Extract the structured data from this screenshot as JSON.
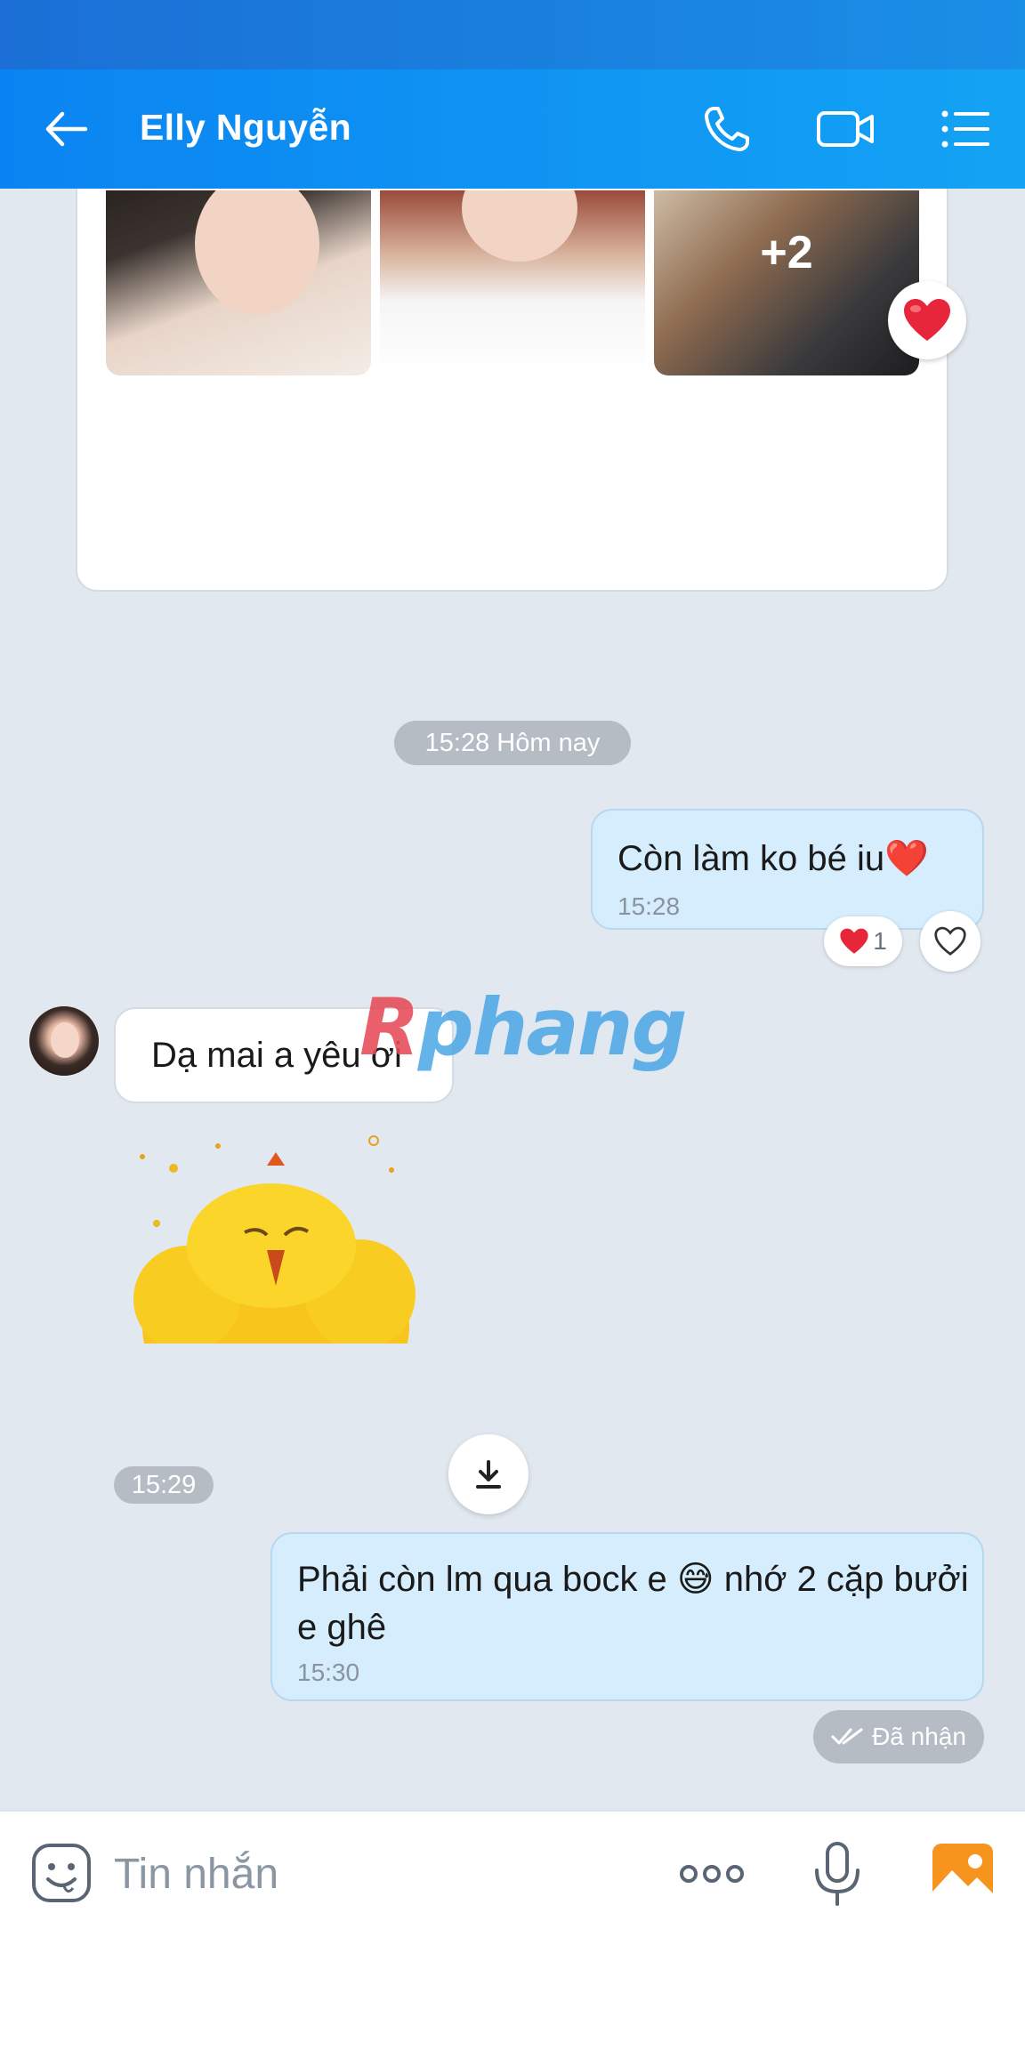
{
  "header": {
    "title": "Elly Nguyễn",
    "back_icon": "arrow-left-icon",
    "call_icon": "phone-icon",
    "video_icon": "video-camera-icon",
    "menu_icon": "list-menu-icon"
  },
  "album": {
    "more_count": "+2",
    "reaction_icon": "heart-icon"
  },
  "messages": [
    {
      "type": "time",
      "text": "15:28 Hôm nay"
    },
    {
      "type": "outgoing",
      "text": "Còn làm ko bé iu❤️",
      "time": "15:28",
      "reaction_count": "1"
    },
    {
      "type": "incoming",
      "text": "Dạ mai a yêu ơi"
    },
    {
      "type": "sticker",
      "icon": "chick-sticker-icon"
    },
    {
      "type": "time",
      "text": "15:29"
    },
    {
      "type": "outgoing",
      "text": "Phải còn lm qua bock e 😅 nhớ 2 cặp bưởi e ghê",
      "time": "15:30",
      "status": "Đã nhận"
    }
  ],
  "watermark": {
    "text_r": "R",
    "text_rest": "phang"
  },
  "composer": {
    "placeholder": "Tin nhắn",
    "emoji_icon": "emoji-icon",
    "more_icon": "more-dots-icon",
    "mic_icon": "microphone-icon",
    "image_icon": "image-icon"
  },
  "colors": {
    "header_bg": "#0a84f2",
    "outgoing_bubble": "#d5edfd",
    "chat_bg": "#e2e8f0",
    "heart": "#e8263b"
  }
}
